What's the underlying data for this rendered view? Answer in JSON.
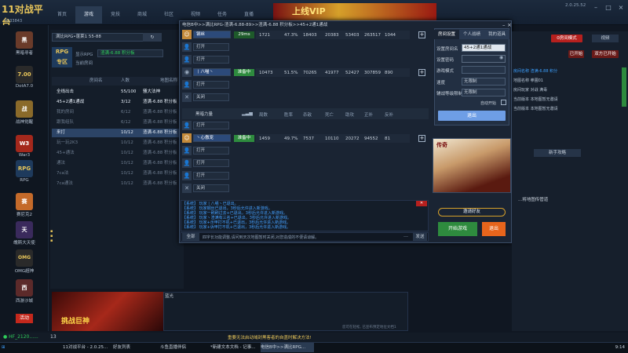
{
  "app": {
    "title": "11对战平台",
    "logo_text": "11对战平台",
    "account": "Y233843"
  },
  "nav_tabs": [
    "首页",
    "游戏",
    "竞技",
    "商城",
    "社区",
    "视频",
    "任务",
    "直播"
  ],
  "vip_banner": "上线VIP",
  "version": "2.0.25.52",
  "left_games": [
    {
      "name": "黑暗寻者",
      "icon": "dark-seeker-icon"
    },
    {
      "name": "DotA7.0",
      "icon": "dota-icon"
    },
    {
      "name": "战神觉醒",
      "icon": "war-god-icon"
    },
    {
      "name": "War3",
      "icon": "war3-icon"
    },
    {
      "name": "RPG",
      "icon": "rpg-icon"
    },
    {
      "name": "赛尼克2",
      "icon": "senike-icon"
    },
    {
      "name": "魄斯大天使",
      "icon": "archangel-icon"
    },
    {
      "name": "OMG超神",
      "icon": "omg-icon"
    },
    {
      "name": "西游沙城",
      "icon": "journey-icon"
    }
  ],
  "room_panel": {
    "room_name": "满比RPG•蓬莱1 55-88",
    "filter_label": "显示RPG",
    "filter_value": "渣满-6.88 积分板",
    "room_label": "当前房间",
    "headers": [
      "房间名",
      "人数",
      "地图名称"
    ],
    "rooms": [
      {
        "name": "全线出击",
        "count": "55/100",
        "map": "骚大法神",
        "style": "hi"
      },
      {
        "name": "45+2通1通战",
        "count": "3/12",
        "map": "渣满-6.88 积分板",
        "style": "hi"
      },
      {
        "name": "我的房间",
        "count": "6/12",
        "map": "渣满-6.88 积分板",
        "style": ""
      },
      {
        "name": "跟我组队",
        "count": "6/12",
        "map": "渣满-6.88 积分板",
        "style": ""
      },
      {
        "name": "来打",
        "count": "10/12",
        "map": "渣满-6.88 积分板",
        "style": "sel"
      },
      {
        "name": "玩一玩2K3",
        "count": "10/12",
        "map": "渣满-6.88 积分板",
        "style": ""
      },
      {
        "name": "45+通法",
        "count": "10/12",
        "map": "渣满-6.88 积分板",
        "style": ""
      },
      {
        "name": "通法",
        "count": "10/12",
        "map": "渣满-6.88 积分板",
        "style": ""
      },
      {
        "name": "7ca法",
        "count": "10/12",
        "map": "渣满-6.88 积分板",
        "style": ""
      },
      {
        "name": "7ca通法",
        "count": "10/12",
        "map": "渣满-6.88 积分板",
        "style": ""
      }
    ]
  },
  "dialog": {
    "title": "电信B中>>满比RPG-渣满-6.88-89>>渣满-6.88 积分板>>45+2通1通战",
    "team1": {
      "rows": [
        {
          "icon": "player-icon",
          "slot": "钢丝",
          "badge": "29ms",
          "stats": [
            "1721",
            "47.3%",
            "18403",
            "20383",
            "53403",
            "263517",
            "1044"
          ]
        },
        {
          "icon": "user-icon",
          "slot": "打开"
        },
        {
          "icon": "user-icon",
          "slot": "打开"
        },
        {
          "icon": "eye-icon",
          "slot": "丨八喵丶",
          "badge": "准备中",
          "stats": [
            "10473",
            "51.5%",
            "70265",
            "41977",
            "52427",
            "307859",
            "890"
          ]
        },
        {
          "icon": "user-icon",
          "slot": "打开"
        },
        {
          "icon": "close-icon",
          "slot": "关闭"
        }
      ]
    },
    "team2_header": {
      "name": "黑暗力量",
      "cols": [
        "局数",
        "胜率",
        "杀敌",
        "死亡",
        "助攻",
        "正补",
        "反补"
      ]
    },
    "team2": {
      "rows": [
        {
          "icon": "user-icon",
          "slot": "打开"
        },
        {
          "icon": "player-icon",
          "slot": "丶心傲宠",
          "badge": "准备中",
          "stats": [
            "1459",
            "49.7%",
            "7537",
            "10110",
            "20272",
            "94552",
            "81"
          ]
        },
        {
          "icon": "user-icon",
          "slot": "打开"
        },
        {
          "icon": "user-icon",
          "slot": "打开"
        },
        {
          "icon": "user-icon",
          "slot": "打开"
        },
        {
          "icon": "close-icon",
          "slot": "关闭"
        }
      ]
    },
    "chat_lines": [
      "【系统】 玩家丨八喵丶已退出。",
      "【系统】 玩家钢丝已退出，3秒后允许进入新游戏。",
      "【系统】 玩家一刷刷过去+已退出，3秒后允许进入新游戏。",
      "【系统】 玩家丶渣满有三名+已退出，3秒后允许进入新游戏。",
      "【系统】 玩家+示甲打不机+已退出，3秒后允许进入新游戏。",
      "【系统】 玩家+诉甲打不机+已退出，3秒后允许进入新游戏。"
    ],
    "chat_prefix": "全部",
    "chat_placeholder": "四字长功能调整,请问到天次地图暂时关闭,对您造成的不便请谅解。",
    "send_label": "发送",
    "settings_tabs": [
      "房间设置",
      "个人战绩",
      "我的道具"
    ],
    "settings": {
      "room_name_label": "设置房间名",
      "room_name_value": "45+2通1通战",
      "password_label": "设置密码",
      "password_value": "",
      "mode_label": "游戏模式",
      "mode_value": "",
      "speed_label": "速度",
      "speed_value": "无限制",
      "level_label": "辅战等级限制",
      "level_value": "无限制",
      "auto_start_label": "自动开始",
      "exit_label": "退出"
    },
    "invite_label": "邀请好友",
    "start_label": "开始游戏",
    "quit_label": "退出"
  },
  "right_panel": {
    "btn1": "0房间模式",
    "btn2": "视频",
    "btn3": "已开始",
    "btn4": "双方已开始",
    "rows": [
      "房间名称  渣满-6.88 积分",
      "地图名称  拳圃01",
      "房间玩家  对战 满毒",
      "当前版本  本地图暂无邀请",
      "当前版本  本地图暂无邀请"
    ],
    "new_feature": "新手攻略",
    "tip": "...将地图传管道"
  },
  "left_banner": "挑战巨神",
  "bottom_panel": {
    "label": "蓝光",
    "footer": "您可在轻松, 已宣布预定地位文档1",
    "online": "13"
  },
  "statusbar": {
    "news": "重要无法启动域封黑客者的自盖时解决方法!",
    "time": "9:14"
  },
  "taskbar": [
    {
      "label": "11对战平台 - 2.0.25...",
      "icon": "platform-icon"
    },
    {
      "label": "好友列表",
      "icon": "friends-icon"
    },
    {
      "label": "斗鱼直播伴侣",
      "icon": "douyu-icon"
    },
    {
      "label": "*新建文本文档 - 记事...",
      "icon": "notepad-icon"
    },
    {
      "label": "电信B中>>满比RPG...",
      "icon": "game-icon"
    }
  ],
  "colors": {
    "accent_green": "#2e8b3e",
    "accent_red": "#b6201e",
    "accent_blue": "#6e9ee6",
    "orange": "#e8651c"
  }
}
